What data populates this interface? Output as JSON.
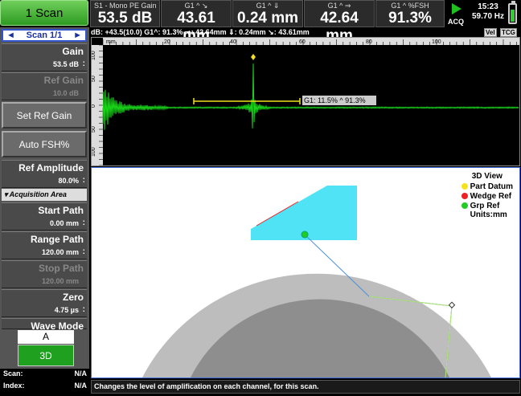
{
  "tab": {
    "label": "1 Scan"
  },
  "readouts": [
    {
      "label": "S1 - Mono PE Gain",
      "value": "53.5 dB"
    },
    {
      "label": "G1 ^ ↘",
      "value": "43.61 mm"
    },
    {
      "label": "G1 ^ ⇓",
      "value": "0.24 mm"
    },
    {
      "label": "G1 ^ ⇒",
      "value": "42.64 mm"
    },
    {
      "label": "G1 ^ %FSH",
      "value": "91.3%"
    }
  ],
  "acq": {
    "label": "ACQ"
  },
  "clock": {
    "time": "15:23",
    "rate": "59.70 Hz"
  },
  "scan_nav": {
    "label": "Scan 1/1",
    "prev": "◄",
    "next": "►"
  },
  "params": [
    {
      "name": "Gain",
      "value": "53.5 dB",
      "dots": ":"
    },
    {
      "name": "Ref Gain",
      "value": "10.0 dB",
      "dots": ""
    },
    {
      "name": "Ref Amplitude",
      "value": "80.0%",
      "dots": ":"
    },
    {
      "name": "Start Path",
      "value": "0.00 mm",
      "dots": ":"
    },
    {
      "name": "Range Path",
      "value": "120.00 mm",
      "dots": ":"
    },
    {
      "name": "Stop Path",
      "value": "120.00 mm",
      "dots": ":"
    },
    {
      "name": "Zero",
      "value": "4.75 µs",
      "dots": ":"
    },
    {
      "name": "Wave Mode",
      "value": "",
      "dots": ""
    }
  ],
  "buttons": {
    "set_ref_gain": "Set Ref Gain",
    "auto_fsh": "Auto FSH%"
  },
  "acq_area": {
    "label": "▾ Acquisition Area"
  },
  "view_mode": {
    "a": "A",
    "three_d": "3D"
  },
  "info": [
    {
      "k": "Scan:",
      "v": "N/A"
    },
    {
      "k": "Index:",
      "v": "N/A"
    }
  ],
  "status": "Changes the level of amplification on each channel, for this scan.",
  "ascan": {
    "header": "dB: +43.5(10.0) G1^: 91.3%   ⇒: 42.64mm  ⇓: 0.24mm   ↘: 43.61mm",
    "vel_tag": "Vel",
    "tcg_tag": "TCG",
    "unit": "mm",
    "ticks": [
      "20",
      "40",
      "60",
      "80",
      "100"
    ],
    "yticks": [
      "100",
      "50",
      "0",
      "50",
      "100"
    ],
    "gate_label": "G1: 11.5% ^ 91.3%",
    "colors": {
      "signal": "#19d619",
      "gate": "#f0e020"
    }
  },
  "view3d": {
    "legend_title": "3D View",
    "legend": [
      {
        "label": "Part Datum",
        "color": "#f5e11e"
      },
      {
        "label": "Wedge Ref",
        "color": "#ee2222"
      },
      {
        "label": "Grp Ref",
        "color": "#22cc22"
      }
    ],
    "units": "Units:mm",
    "colors": {
      "wedge": "#4fe3f5",
      "part_outer": "#bdbdbd",
      "part_inner": "#8e8e8e"
    }
  }
}
